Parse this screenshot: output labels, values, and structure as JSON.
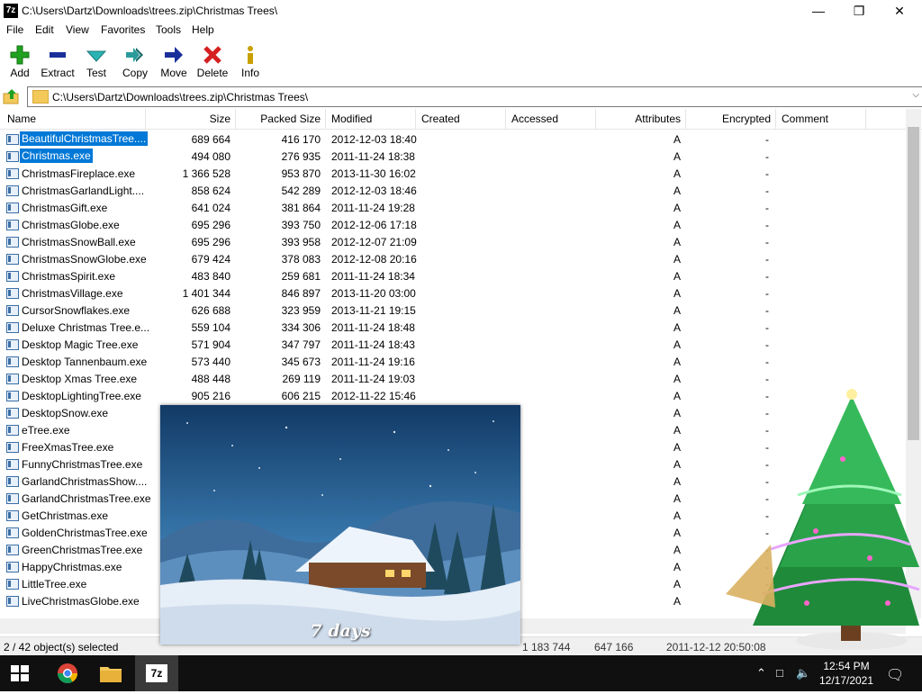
{
  "window": {
    "app_icon": "7z",
    "title": "C:\\Users\\Dartz\\Downloads\\trees.zip\\Christmas Trees\\",
    "controls": {
      "minimize": "—",
      "maximize": "❐",
      "close": "✕"
    }
  },
  "menu": [
    "File",
    "Edit",
    "View",
    "Favorites",
    "Tools",
    "Help"
  ],
  "toolbar": [
    {
      "label": "Add",
      "icon": "plus-icon",
      "color": "#21a121"
    },
    {
      "label": "Extract",
      "icon": "minus-icon",
      "color": "#1a2f9a"
    },
    {
      "label": "Test",
      "icon": "check-icon",
      "color": "#2bb3b3"
    },
    {
      "label": "Copy",
      "icon": "double-arrow-icon",
      "color": "#2a9a9a"
    },
    {
      "label": "Move",
      "icon": "arrow-right-icon",
      "color": "#1a2f9a"
    },
    {
      "label": "Delete",
      "icon": "x-icon",
      "color": "#d42020"
    },
    {
      "label": "Info",
      "icon": "info-icon",
      "color": "#c8a000"
    }
  ],
  "address": {
    "path": "C:\\Users\\Dartz\\Downloads\\trees.zip\\Christmas Trees\\"
  },
  "columns": [
    "Name",
    "Size",
    "Packed Size",
    "Modified",
    "Created",
    "Accessed",
    "Attributes",
    "Encrypted",
    "Comment"
  ],
  "files": [
    {
      "name": "BeautifulChristmasTree....",
      "size": "689 664",
      "packed": "416 170",
      "modified": "2012-12-03 18:40",
      "attr": "A",
      "enc": "-",
      "selected": true
    },
    {
      "name": "Christmas.exe",
      "size": "494 080",
      "packed": "276 935",
      "modified": "2011-11-24 18:38",
      "attr": "A",
      "enc": "-",
      "selected": true
    },
    {
      "name": "ChristmasFireplace.exe",
      "size": "1 366 528",
      "packed": "953 870",
      "modified": "2013-11-30 16:02",
      "attr": "A",
      "enc": "-"
    },
    {
      "name": "ChristmasGarlandLight....",
      "size": "858 624",
      "packed": "542 289",
      "modified": "2012-12-03 18:46",
      "attr": "A",
      "enc": "-"
    },
    {
      "name": "ChristmasGift.exe",
      "size": "641 024",
      "packed": "381 864",
      "modified": "2011-11-24 19:28",
      "attr": "A",
      "enc": "-"
    },
    {
      "name": "ChristmasGlobe.exe",
      "size": "695 296",
      "packed": "393 750",
      "modified": "2012-12-06 17:18",
      "attr": "A",
      "enc": "-"
    },
    {
      "name": "ChristmasSnowBall.exe",
      "size": "695 296",
      "packed": "393 958",
      "modified": "2012-12-07 21:09",
      "attr": "A",
      "enc": "-"
    },
    {
      "name": "ChristmasSnowGlobe.exe",
      "size": "679 424",
      "packed": "378 083",
      "modified": "2012-12-08 20:16",
      "attr": "A",
      "enc": "-"
    },
    {
      "name": "ChristmasSpirit.exe",
      "size": "483 840",
      "packed": "259 681",
      "modified": "2011-11-24 18:34",
      "attr": "A",
      "enc": "-"
    },
    {
      "name": "ChristmasVillage.exe",
      "size": "1 401 344",
      "packed": "846 897",
      "modified": "2013-11-20 03:00",
      "attr": "A",
      "enc": "-"
    },
    {
      "name": "CursorSnowflakes.exe",
      "size": "626 688",
      "packed": "323 959",
      "modified": "2013-11-21 19:15",
      "attr": "A",
      "enc": "-"
    },
    {
      "name": "Deluxe Christmas Tree.e...",
      "size": "559 104",
      "packed": "334 306",
      "modified": "2011-11-24 18:48",
      "attr": "A",
      "enc": "-"
    },
    {
      "name": "Desktop Magic Tree.exe",
      "size": "571 904",
      "packed": "347 797",
      "modified": "2011-11-24 18:43",
      "attr": "A",
      "enc": "-"
    },
    {
      "name": "Desktop Tannenbaum.exe",
      "size": "573 440",
      "packed": "345 673",
      "modified": "2011-11-24 19:16",
      "attr": "A",
      "enc": "-"
    },
    {
      "name": "Desktop Xmas Tree.exe",
      "size": "488 448",
      "packed": "269 119",
      "modified": "2011-11-24 19:03",
      "attr": "A",
      "enc": "-"
    },
    {
      "name": "DesktopLightingTree.exe",
      "size": "905 216",
      "packed": "606 215",
      "modified": "2012-11-22 15:46",
      "attr": "A",
      "enc": "-"
    },
    {
      "name": "DesktopSnow.exe",
      "size": "",
      "packed": "",
      "modified": "",
      "attr": "A",
      "enc": "-"
    },
    {
      "name": "eTree.exe",
      "size": "",
      "packed": "",
      "modified": "",
      "attr": "A",
      "enc": "-"
    },
    {
      "name": "FreeXmasTree.exe",
      "size": "",
      "packed": "",
      "modified": "",
      "attr": "A",
      "enc": "-"
    },
    {
      "name": "FunnyChristmasTree.exe",
      "size": "",
      "packed": "",
      "modified": "",
      "attr": "A",
      "enc": "-"
    },
    {
      "name": "GarlandChristmasShow....",
      "size": "",
      "packed": "",
      "modified": "",
      "attr": "A",
      "enc": "-"
    },
    {
      "name": "GarlandChristmasTree.exe",
      "size": "",
      "packed": "",
      "modified": "",
      "attr": "A",
      "enc": "-"
    },
    {
      "name": "GetChristmas.exe",
      "size": "",
      "packed": "",
      "modified": "",
      "attr": "A",
      "enc": "-"
    },
    {
      "name": "GoldenChristmasTree.exe",
      "size": "",
      "packed": "",
      "modified": "",
      "attr": "A",
      "enc": "-"
    },
    {
      "name": "GreenChristmasTree.exe",
      "size": "",
      "packed": "",
      "modified": "",
      "attr": "A",
      "enc": "-"
    },
    {
      "name": "HappyChristmas.exe",
      "size": "",
      "packed": "",
      "modified": "",
      "attr": "A",
      "enc": "-"
    },
    {
      "name": "LittleTree.exe",
      "size": "",
      "packed": "",
      "modified": "",
      "attr": "A",
      "enc": "-"
    },
    {
      "name": "LiveChristmasGlobe.exe",
      "size": "",
      "packed": "",
      "modified": "",
      "attr": "A",
      "enc": "-"
    }
  ],
  "status": {
    "text": "2 / 42 object(s) selected",
    "size": "1 183 744",
    "packed": "647 166",
    "modified": "2011-12-12 20:50:08"
  },
  "popup": {
    "caption": "7 days"
  },
  "taskbar": {
    "apps": [
      {
        "name": "chrome-icon"
      },
      {
        "name": "file-explorer-icon"
      },
      {
        "name": "7zip-icon",
        "active": true,
        "label": "7z"
      }
    ],
    "time": "12:54 PM",
    "date": "12/17/2021"
  }
}
